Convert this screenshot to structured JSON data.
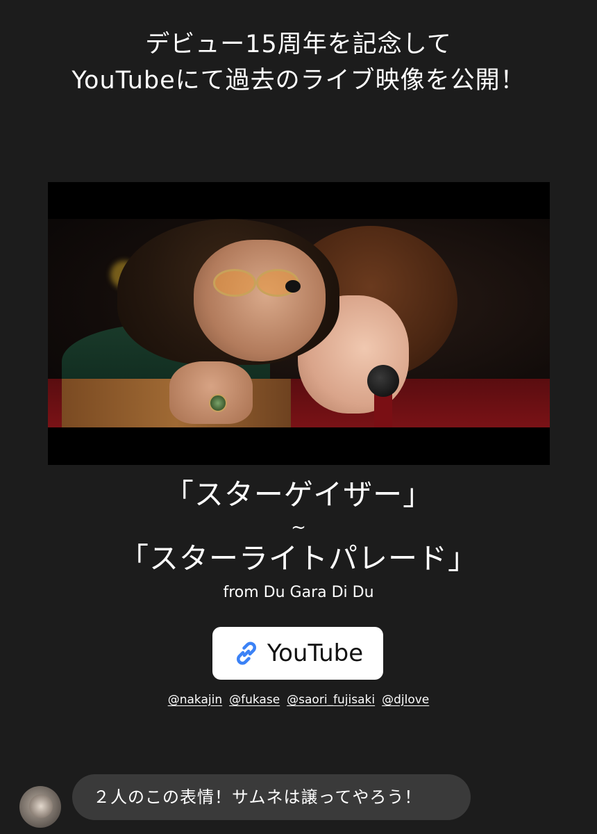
{
  "headline": {
    "line1": "デビュー15周年を記念して",
    "line2": "YouTubeにて過去のライブ映像を公開！"
  },
  "songs": {
    "title1": "「スターゲイザー」",
    "separator": "~",
    "title2": "「スターライトパレード」",
    "from": "from  Du Gara Di Du"
  },
  "link_button": {
    "icon": "link-icon",
    "label": "YouTube",
    "icon_color": "#3b82f6"
  },
  "mentions": [
    "@nakajin",
    "@fukase",
    "@saori_fujisaki",
    "@djlove"
  ],
  "reply": {
    "text": "２人のこの表情！サムネは譲ってやろう！"
  }
}
